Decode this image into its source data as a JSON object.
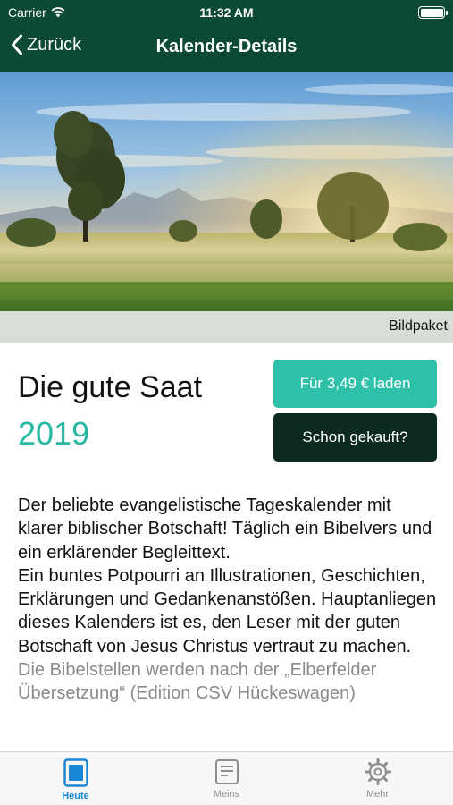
{
  "status_bar": {
    "carrier": "Carrier",
    "time": "11:32 AM"
  },
  "nav": {
    "back_label": "Zurück",
    "title": "Kalender-Details"
  },
  "hero": {
    "package_label": "Bildpaket"
  },
  "product": {
    "name": "Die gute Saat",
    "year": "2019",
    "buy_label": "Für 3,49 € laden",
    "owned_label": "Schon gekauft?"
  },
  "description": {
    "paragraph": "Der beliebte evangelistische Tageskalender mit klarer biblischer Botschaft! Täglich ein Bibelvers und ein erklärender Begleittext.",
    "paragraph2": "Ein buntes Potpourri an Illustrationen, Geschichten, Erklärungen und Gedankenanstößen. Hauptanliegen dieses Kalenders ist es, den Leser mit der guten Botschaft von Jesus Christus vertraut zu machen.",
    "note": "Die Bibelstellen werden nach der „Elberfelder Übersetzung“ (Edition CSV Hückeswagen)"
  },
  "tabs": [
    {
      "label": "Heute",
      "icon": "calendar-icon",
      "active": true
    },
    {
      "label": "Meins",
      "icon": "notes-icon",
      "active": false
    },
    {
      "label": "Mehr",
      "icon": "gear-icon",
      "active": false
    }
  ],
  "colors": {
    "nav_background": "#0d4a35",
    "accent": "#2ec0a8",
    "dark_button": "#0c2a1f",
    "tab_active": "#1a86d6"
  }
}
